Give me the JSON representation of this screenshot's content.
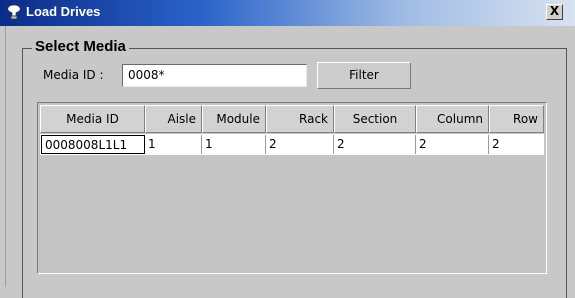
{
  "window": {
    "title": "Load Drives",
    "close_label": "X",
    "icon": "app-icon"
  },
  "select_media": {
    "title": "Select Media",
    "media_id_label": "Media ID :",
    "media_id_value": "0008*",
    "filter_label": "Filter"
  },
  "table": {
    "columns": [
      "Media ID",
      "Aisle",
      "Module",
      "Rack",
      "Section",
      "Column",
      "Row"
    ],
    "rows": [
      [
        "0008008L1L1",
        "1",
        "1",
        "2",
        "2",
        "2",
        "2"
      ]
    ]
  }
}
